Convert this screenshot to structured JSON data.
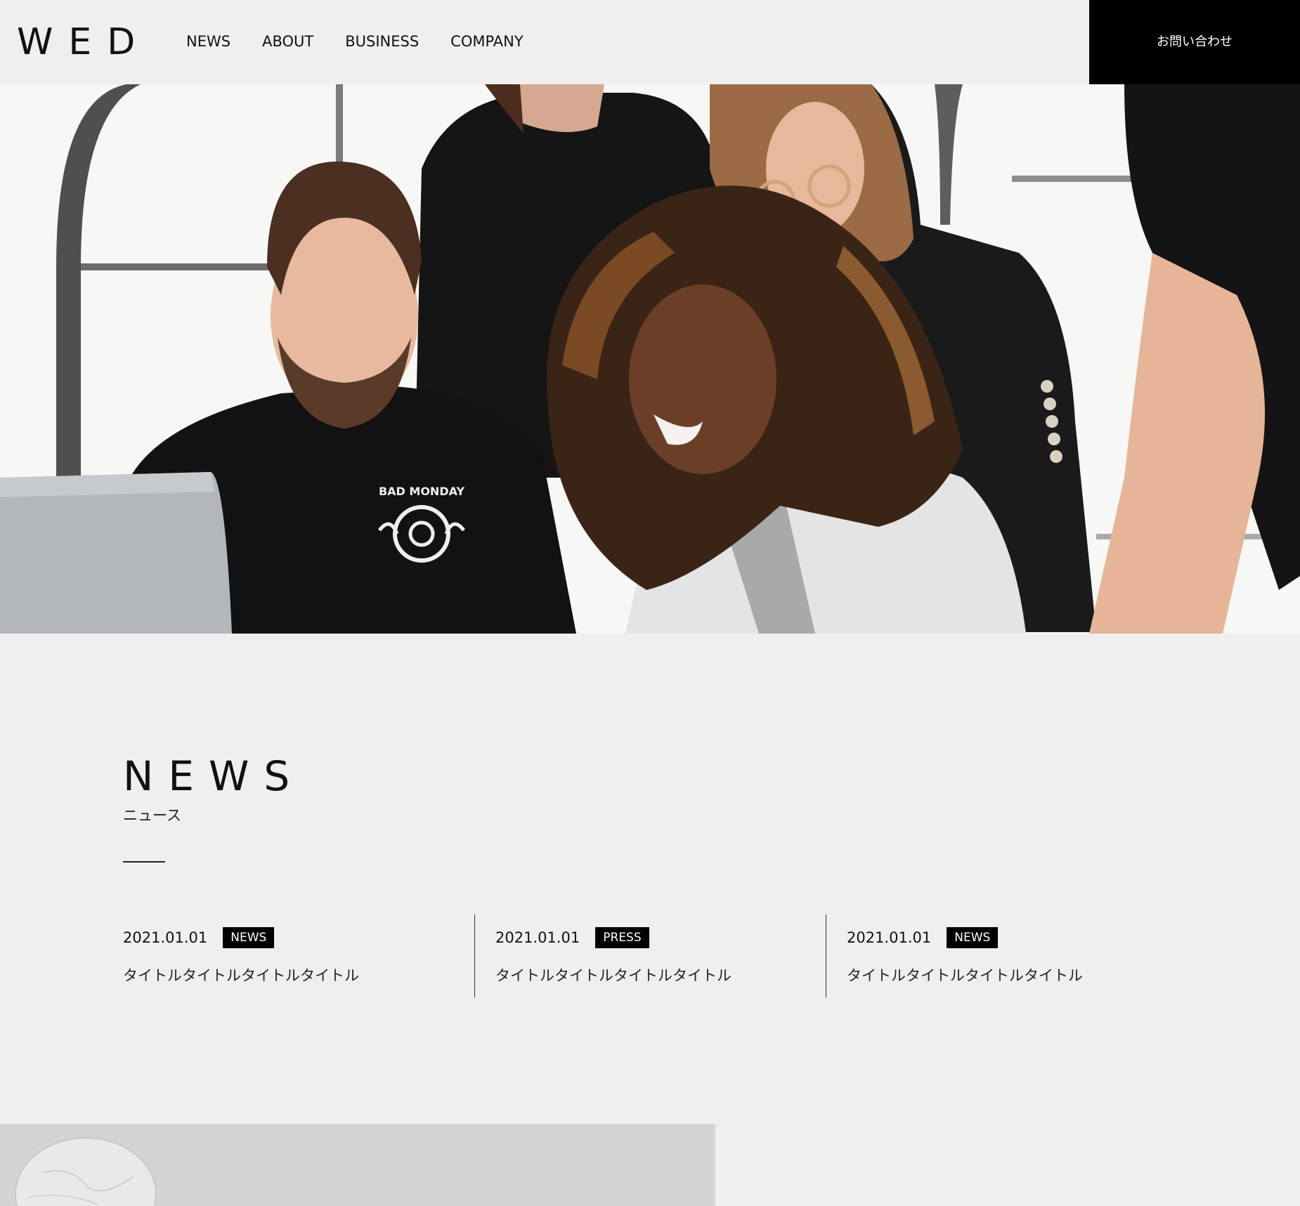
{
  "header": {
    "logo": "WED",
    "nav": [
      {
        "label": "NEWS"
      },
      {
        "label": "ABOUT"
      },
      {
        "label": "BUSINESS"
      },
      {
        "label": "COMPANY"
      }
    ],
    "contact_label": "お問い合わせ"
  },
  "hero": {
    "shirt_print": "BAD MONDAY"
  },
  "news": {
    "title": "NEWS",
    "subtitle": "ニュース",
    "items": [
      {
        "date": "2021.01.01",
        "tag": "NEWS",
        "title": "タイトルタイトルタイトルタイトル"
      },
      {
        "date": "2021.01.01",
        "tag": "PRESS",
        "title": "タイトルタイトルタイトルタイトル"
      },
      {
        "date": "2021.01.01",
        "tag": "NEWS",
        "title": "タイトルタイトルタイトルタイトル"
      }
    ]
  },
  "colors": {
    "page_background": "#efefef",
    "contact_button": "#000000",
    "tag_background": "#000000",
    "text": "#111111"
  }
}
